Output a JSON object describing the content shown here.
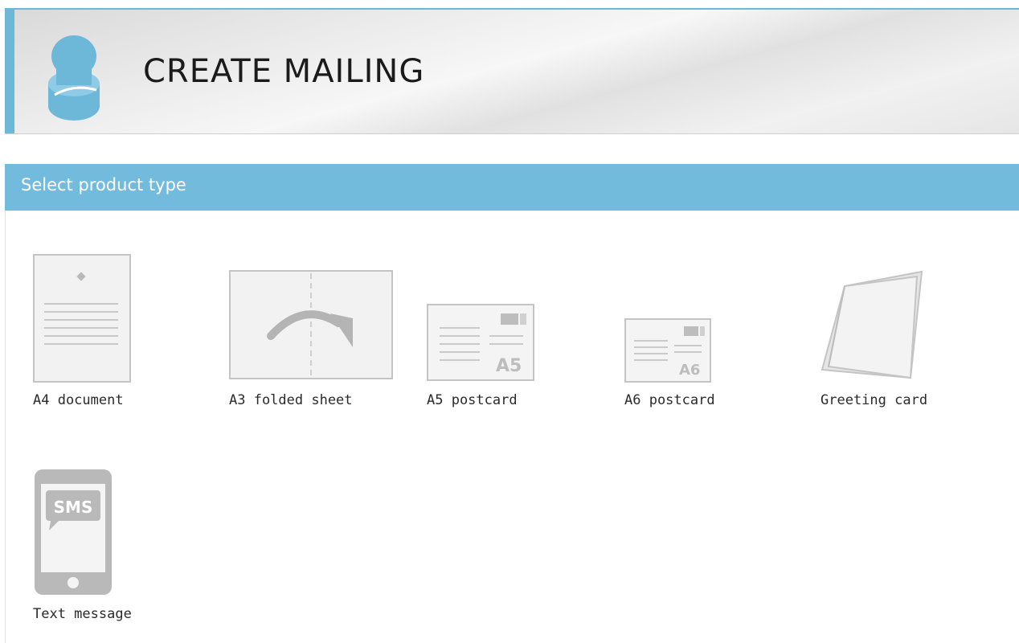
{
  "header": {
    "title": "CREATE MAILING",
    "logo_icon": "stamp-icon",
    "accent_color": "#6db8d9"
  },
  "section": {
    "title": "Select product type",
    "bar_color": "#72bbdd"
  },
  "products": [
    {
      "label": "A4 document",
      "icon": "a4-document-icon"
    },
    {
      "label": "A3 folded sheet",
      "icon": "a3-folded-sheet-icon"
    },
    {
      "label": "A5 postcard",
      "icon": "a5-postcard-icon",
      "badge": "A5"
    },
    {
      "label": "A6 postcard",
      "icon": "a6-postcard-icon",
      "badge": "A6"
    },
    {
      "label": "Greeting card",
      "icon": "greeting-card-icon"
    },
    {
      "label": "Text message",
      "icon": "phone-sms-icon",
      "badge": "SMS"
    }
  ]
}
